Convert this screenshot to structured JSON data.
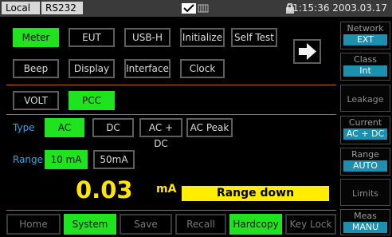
{
  "status": {
    "local": "Local",
    "rs232": "RS232",
    "datetime": "01:15:36 2003.03.17"
  },
  "menu": {
    "row1": [
      "Meter",
      "EUT",
      "USB-H",
      "Initialize",
      "Self Test"
    ],
    "row2": [
      "Beep",
      "Display",
      "Interface",
      "Clock"
    ]
  },
  "mode": {
    "volt": "VOLT",
    "pcc": "PCC"
  },
  "type": {
    "label": "Type",
    "options": [
      "AC",
      "DC",
      "AC + DC",
      "AC Peak"
    ]
  },
  "range": {
    "label": "Range",
    "options": [
      "10 mA",
      "50mA"
    ]
  },
  "measurement": {
    "value": "0.03",
    "unit": "mA",
    "message": "Range down"
  },
  "right_panel": {
    "network": {
      "title": "Network",
      "value": "EXT"
    },
    "class": {
      "title": "Class",
      "value": "Int"
    },
    "leakage": "Leakage",
    "current": {
      "title": "Current",
      "value": "AC + DC"
    },
    "range": {
      "title": "Range",
      "value": "AUTO"
    },
    "limits": "Limits",
    "meas": {
      "title": "Meas",
      "value": "MANU"
    }
  },
  "softkeys": [
    "Home",
    "System",
    "Save",
    "Recall",
    "Hardcopy",
    "Key Lock"
  ],
  "colors": {
    "active": "#1ee31e",
    "separator": "#b8651e",
    "measurement": "#ffe600",
    "panel_value": "#1d8fb0"
  }
}
